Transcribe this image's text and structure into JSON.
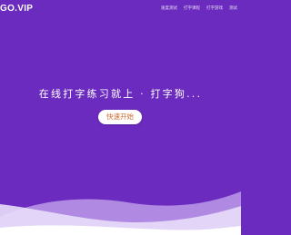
{
  "header": {
    "logo_text": "GO.VIP",
    "nav": [
      {
        "label": "速度测试"
      },
      {
        "label": "打字课程"
      },
      {
        "label": "打字游戏"
      },
      {
        "label": "测试"
      }
    ]
  },
  "hero": {
    "title": "在线打字练习就上 · 打字狗...",
    "start_button_label": "快速开始"
  },
  "colors": {
    "background": "#6b2bbe",
    "button_text": "#d06a2c",
    "wave_light": "#ffffff",
    "wave_mid": "#e9defa",
    "wave_dark": "#c6a9ee"
  }
}
